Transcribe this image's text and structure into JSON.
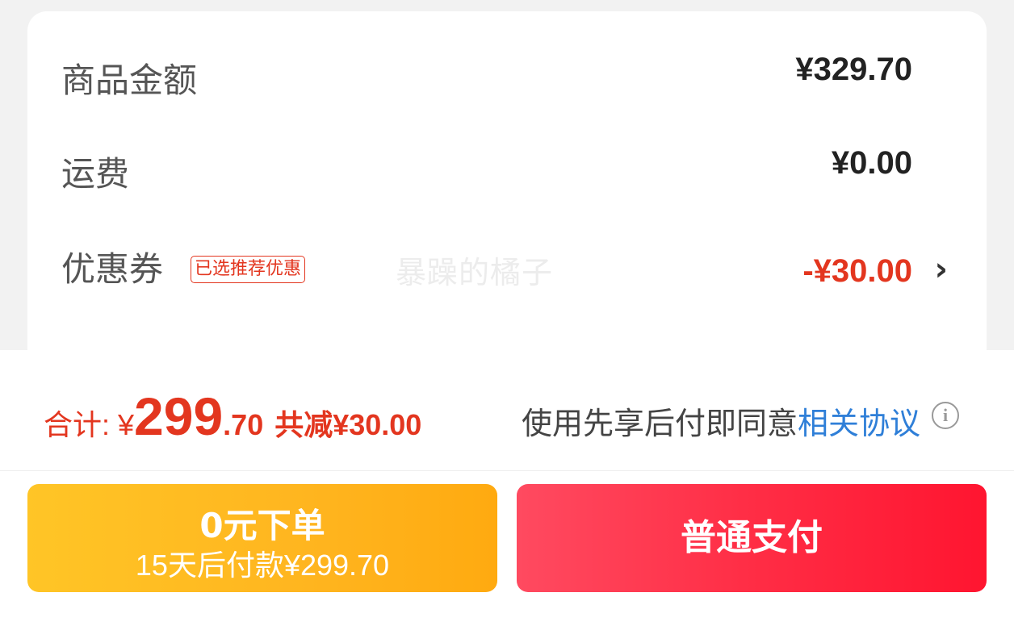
{
  "order": {
    "rows": [
      {
        "label": "商品金额",
        "value": "¥329.70"
      },
      {
        "label": "运费",
        "value": "¥0.00"
      },
      {
        "label": "优惠券",
        "tag": "已选推荐优惠",
        "value": "-¥30.00",
        "has_chevron": true
      },
      {
        "label": "",
        "value": ""
      }
    ],
    "watermark": "暴躁的橘子"
  },
  "summary": {
    "total_label": "合计:",
    "currency": "¥",
    "total_int": "299",
    "total_dec": ".70",
    "saved": "共减¥30.00",
    "agree_text": "使用先享后付即同意",
    "agree_link": "相关协议"
  },
  "actions": {
    "bnpl_main": "0元下单",
    "bnpl_sub": "15天后付款¥299.70",
    "pay": "普通支付"
  },
  "colors": {
    "accent_red": "#e3361f",
    "link_blue": "#2f7fd8",
    "bnpl_yellow": "#ffb51f",
    "pay_red": "#ff2d45"
  },
  "icons": {
    "chevron": "chevron-right-icon",
    "info": "info-icon"
  }
}
